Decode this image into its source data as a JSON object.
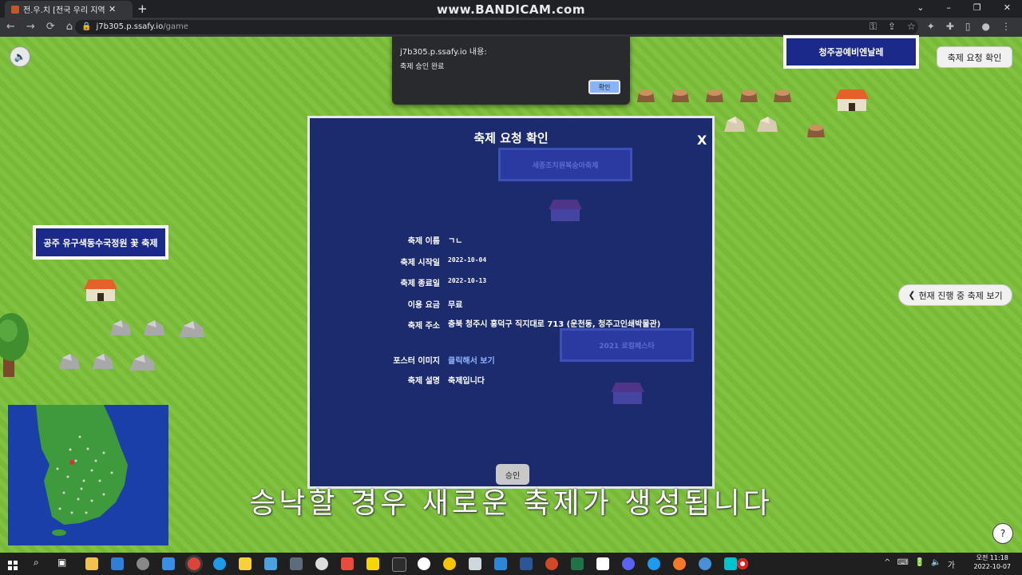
{
  "browser": {
    "tab_title": "전.우.치 [전국 우리 지역잔치",
    "tab_close": "✕",
    "new_tab": "+",
    "watermark": "www.BANDICAM.com",
    "url_host": "j7b305.p.ssafy.io",
    "url_path": "/game",
    "window_controls": [
      "⌄",
      "–",
      "❐",
      "✕"
    ],
    "nav": [
      "←",
      "→",
      "⟳",
      "⌂"
    ]
  },
  "alert": {
    "title": "j7b305.p.ssafy.io 내용:",
    "message": "축제 승인 완료",
    "ok_label": "확인"
  },
  "game": {
    "speaker_icon": "🔈",
    "label_top_right": "청주공예비엔날레",
    "request_button": "축제 요청 확인",
    "label_left": "공주 유구색동수국정원 꽃 축제",
    "current_festivals_button": "현재 진행 중 축제 보기",
    "chevron": "❮",
    "help_icon": "?"
  },
  "modal": {
    "title": "축제 요청 확인",
    "close": "X",
    "ghost_label_1": "세종조치원복숭아축제",
    "ghost_label_2": "2021 로컬페스타",
    "rows": [
      {
        "label": "축제 이름",
        "value": "ㄱㄴ"
      },
      {
        "label": "축제 시작일",
        "value": "2022-10-04"
      },
      {
        "label": "축제 종료일",
        "value": "2022-10-13"
      },
      {
        "label": "이용 요금",
        "value": "무료"
      },
      {
        "label": "축제 주소",
        "value": "충북 청주시 흥덕구 직지대로 713 (운천동, 청주고인쇄박물관)"
      },
      {
        "label": "포스터 이미지",
        "value": "클릭해서 보기"
      },
      {
        "label": "축제 설명",
        "value": "축제입니다"
      }
    ],
    "approve_label": "승인"
  },
  "subtitle": "승낙할 경우 새로운 축제가 생성됩니다",
  "taskbar": {
    "time": "오전 11:18",
    "date": "2022-10-07",
    "tray_icons": [
      "^",
      "⌨",
      "🔋",
      "🔈",
      "가"
    ]
  },
  "colors": {
    "grass": "#7cbf3a",
    "modal_bg": "#1c2a6e",
    "label_bg": "#1b2a8a"
  }
}
